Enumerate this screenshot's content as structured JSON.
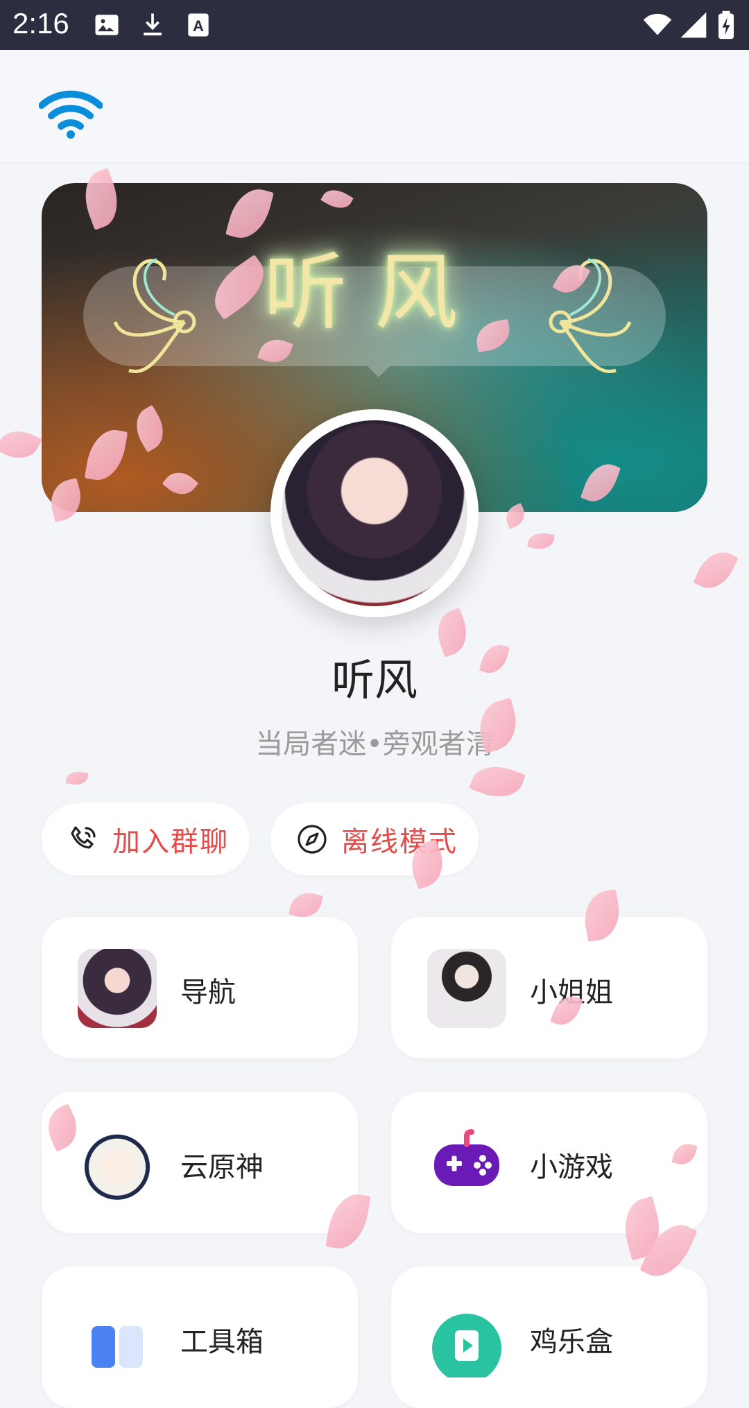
{
  "status_bar": {
    "time": "2:16",
    "notification_icons": [
      "image-icon",
      "download-icon",
      "font-icon"
    ],
    "system_icons": [
      "wifi-icon",
      "signal-icon",
      "battery-charging-icon"
    ]
  },
  "header": {
    "icon": "wifi-icon",
    "accent_color": "#0a8ed9"
  },
  "banner": {
    "title": "听风"
  },
  "profile": {
    "name": "听风",
    "motto": "当局者迷•旁观者清"
  },
  "actions": [
    {
      "label": "加入群聊",
      "icon": "phone-icon"
    },
    {
      "label": "离线模式",
      "icon": "compass-icon"
    }
  ],
  "cards": [
    {
      "label": "导航",
      "icon": "anime-girl-thumbnail"
    },
    {
      "label": "小姐姐",
      "icon": "girl-photo-thumbnail"
    },
    {
      "label": "云原神",
      "icon": "genshin-paimon-icon"
    },
    {
      "label": "小游戏",
      "icon": "gamepad-icon"
    },
    {
      "label": "工具箱",
      "icon": "toolbox-icon"
    },
    {
      "label": "鸡乐盒",
      "icon": "play-icon"
    }
  ],
  "colors": {
    "action_text": "#e44b4b",
    "background": "#f4f5f8",
    "status_bar": "#2c2d3f"
  }
}
